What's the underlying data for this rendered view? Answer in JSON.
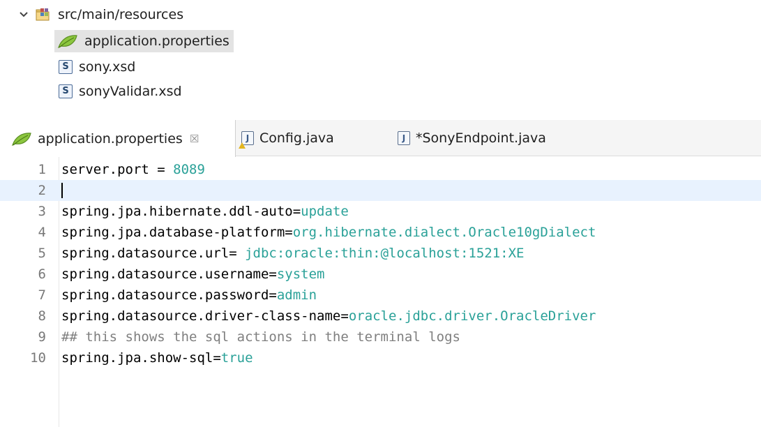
{
  "tree": {
    "folder": {
      "label": "src/main/resources",
      "expanded": true
    },
    "items": [
      {
        "label": "application.properties",
        "icon": "leaf-icon",
        "selected": true
      },
      {
        "label": "sony.xsd",
        "icon": "xsd-file-icon",
        "badge": "S"
      },
      {
        "label": "sonyValidar.xsd",
        "icon": "xsd-file-icon",
        "badge": "S"
      }
    ]
  },
  "tabs": [
    {
      "label": "application.properties",
      "active": true,
      "close": "☒"
    },
    {
      "label": "Config.java",
      "icon_badge": "J"
    },
    {
      "label": "*SonyEndpoint.java",
      "icon_badge": "J"
    }
  ],
  "editor": {
    "lines": [
      {
        "num": "1",
        "key": "server.port = ",
        "value": "8089"
      },
      {
        "num": "2",
        "key": "",
        "value": "",
        "current": true
      },
      {
        "num": "3",
        "key": "spring.jpa.hibernate.ddl-auto=",
        "value": "update"
      },
      {
        "num": "4",
        "key": "spring.jpa.database-platform=",
        "value": "org.hibernate.dialect.Oracle10gDialect"
      },
      {
        "num": "5",
        "key": "spring.datasource.url= ",
        "value": "jdbc:oracle:thin:@localhost:1521:XE"
      },
      {
        "num": "6",
        "key": "spring.datasource.username=",
        "value": "system"
      },
      {
        "num": "7",
        "key": "spring.datasource.password=",
        "value": "admin"
      },
      {
        "num": "8",
        "key": "spring.datasource.driver-class-name=",
        "value": "oracle.jdbc.driver.OracleDriver"
      },
      {
        "num": "9",
        "comment": "## this shows the sql actions in the terminal logs"
      },
      {
        "num": "10",
        "key": "spring.jpa.show-sql=",
        "value": "true"
      }
    ]
  },
  "colors": {
    "value": "#2aa198",
    "comment": "#7f7f7f",
    "current_line": "#e8f2fe",
    "selection": "#e3e3e3"
  }
}
